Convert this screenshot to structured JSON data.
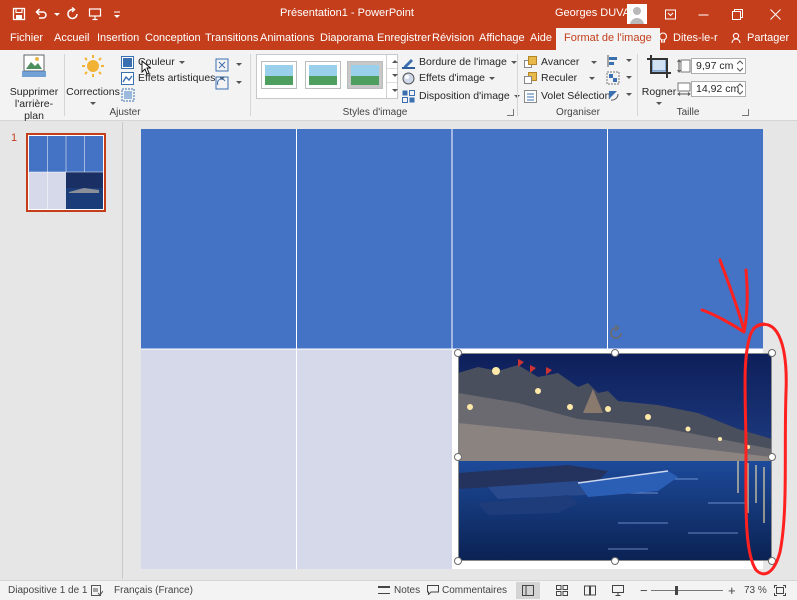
{
  "window": {
    "title": "Présentation1  -  PowerPoint",
    "user": "Georges DUVAL"
  },
  "colors": {
    "brand": "#c43e1c",
    "slide_blue": "#4472c4",
    "slide_light": "#d5d9ea",
    "annotation_red": "#ff2020"
  },
  "tabs": [
    {
      "label": "Fichier"
    },
    {
      "label": "Accueil"
    },
    {
      "label": "Insertion"
    },
    {
      "label": "Conception"
    },
    {
      "label": "Transitions"
    },
    {
      "label": "Animations"
    },
    {
      "label": "Diaporama"
    },
    {
      "label": "Enregistrer"
    },
    {
      "label": "Révision"
    },
    {
      "label": "Affichage"
    },
    {
      "label": "Aide"
    },
    {
      "label": "Format de l'image"
    },
    {
      "label": "Dites-le-r"
    },
    {
      "label": "Partager"
    }
  ],
  "ribbon": {
    "ajuster": {
      "label": "Ajuster",
      "remove_bg_line1": "Supprimer",
      "remove_bg_line2": "l'arrière-plan",
      "corrections": "Corrections",
      "couleur": "Couleur",
      "effets_artistiques": "Effets artistiques"
    },
    "styles": {
      "label": "Styles d'image",
      "bordure": "Bordure de l'image",
      "effets": "Effets d'image",
      "disposition": "Disposition d'image"
    },
    "organiser": {
      "label": "Organiser",
      "avancer": "Avancer",
      "reculer": "Reculer",
      "volet": "Volet Sélection"
    },
    "taille": {
      "label": "Taille",
      "rogner": "Rogner",
      "height": "9,97 cm",
      "width": "14,92 cm"
    }
  },
  "thumbnails": {
    "slide_number": "1"
  },
  "status": {
    "slide_info": "Diapositive 1 de 1",
    "language": "Français (France)",
    "notes": "Notes",
    "comments": "Commentaires",
    "zoom": "73 %"
  }
}
